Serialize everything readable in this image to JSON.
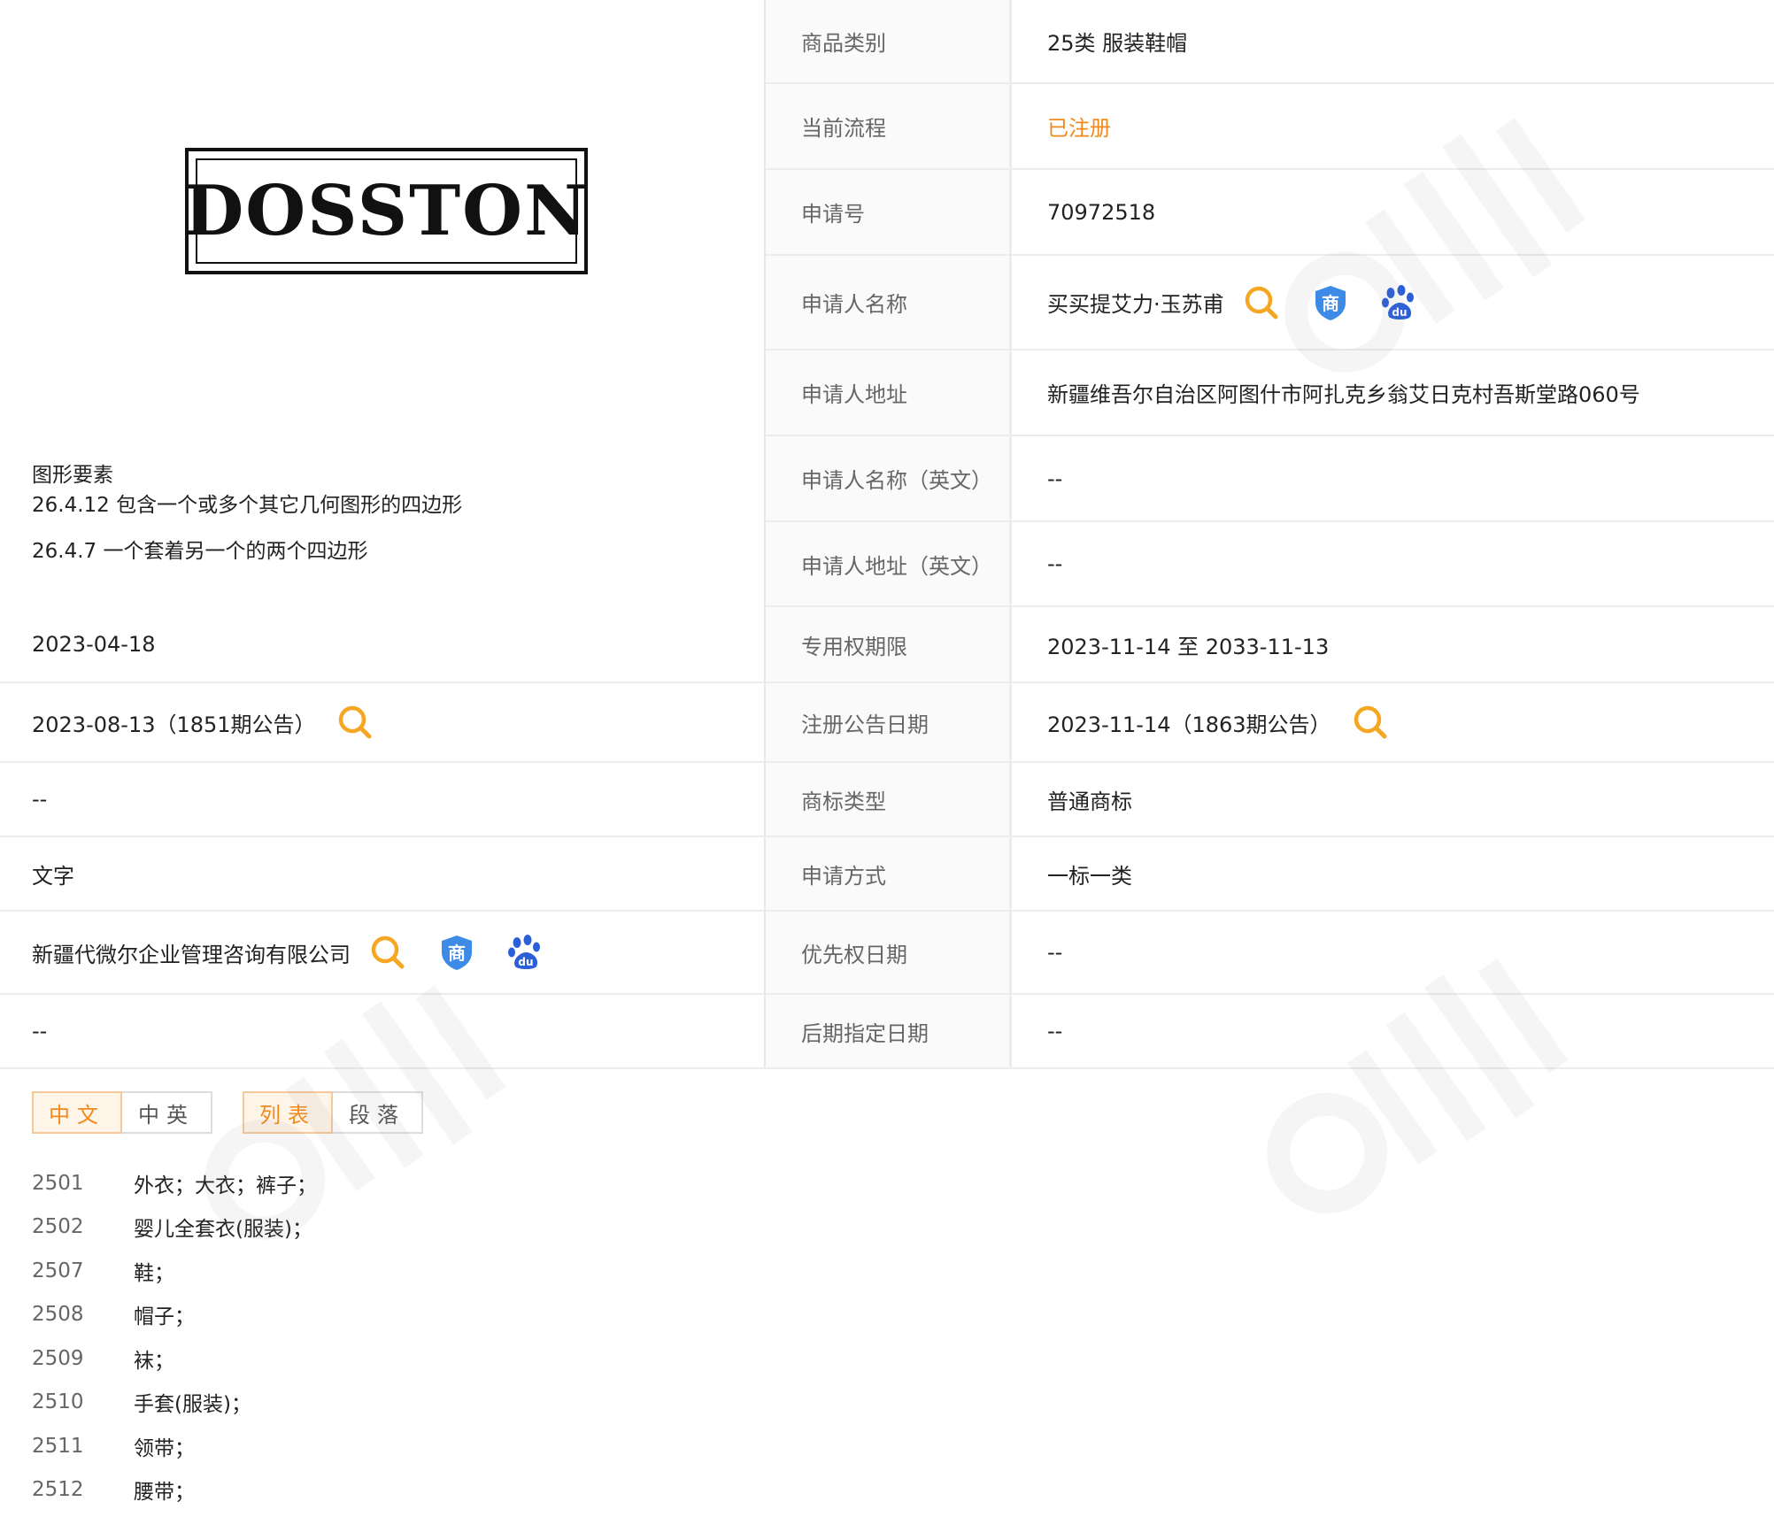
{
  "logo": {
    "text": "DOSSTON"
  },
  "elements": {
    "title": "图形要素",
    "items": [
      "26.4.12 包含一个或多个其它几何图形的四边形",
      "26.4.7 一个套着另一个的两个四边形"
    ]
  },
  "left_rows": [
    {
      "value": "2023-04-18"
    },
    {
      "value": "2023-08-13（1851期公告）"
    },
    {
      "value": "--"
    },
    {
      "value": "文字"
    },
    {
      "value": "新疆代微尔企业管理咨询有限公司"
    },
    {
      "value": "--"
    }
  ],
  "right_rows": [
    {
      "label": "商品类别",
      "value": "25类 服装鞋帽"
    },
    {
      "label": "当前流程",
      "value": "已注册"
    },
    {
      "label": "申请号",
      "value": "70972518"
    },
    {
      "label": "申请人名称",
      "value": "买买提艾力·玉苏甫"
    },
    {
      "label": "申请人地址",
      "value": "新疆维吾尔自治区阿图什市阿扎克乡翁艾日克村吾斯堂路060号"
    },
    {
      "label": "申请人名称（英文）",
      "value": "--"
    },
    {
      "label": "申请人地址（英文）",
      "value": "--"
    },
    {
      "label": "专用权期限",
      "value": "2023-11-14 至 2033-11-13"
    },
    {
      "label": "注册公告日期",
      "value": "2023-11-14（1863期公告）"
    },
    {
      "label": "商标类型",
      "value": "普通商标"
    },
    {
      "label": "申请方式",
      "value": "一标一类"
    },
    {
      "label": "优先权日期",
      "value": "--"
    },
    {
      "label": "后期指定日期",
      "value": "--"
    }
  ],
  "toggles": {
    "lang": [
      "中文",
      "中英"
    ],
    "view": [
      "列表",
      "段落"
    ]
  },
  "goods": [
    {
      "code": "2501",
      "name": "外衣；大衣；裤子；"
    },
    {
      "code": "2502",
      "name": "婴儿全套衣(服装)；"
    },
    {
      "code": "2507",
      "name": "鞋；"
    },
    {
      "code": "2508",
      "name": "帽子；"
    },
    {
      "code": "2509",
      "name": "袜；"
    },
    {
      "code": "2510",
      "name": "手套(服装)；"
    },
    {
      "code": "2511",
      "name": "领带；"
    },
    {
      "code": "2512",
      "name": "腰带；"
    }
  ],
  "icons": {
    "search": "search-icon",
    "shang": "shang-badge-icon",
    "baidu": "baidu-paw-icon"
  },
  "colors": {
    "accent": "#f08a1c",
    "badge": "#3d8be6",
    "baidu": "#2b5fd9"
  }
}
